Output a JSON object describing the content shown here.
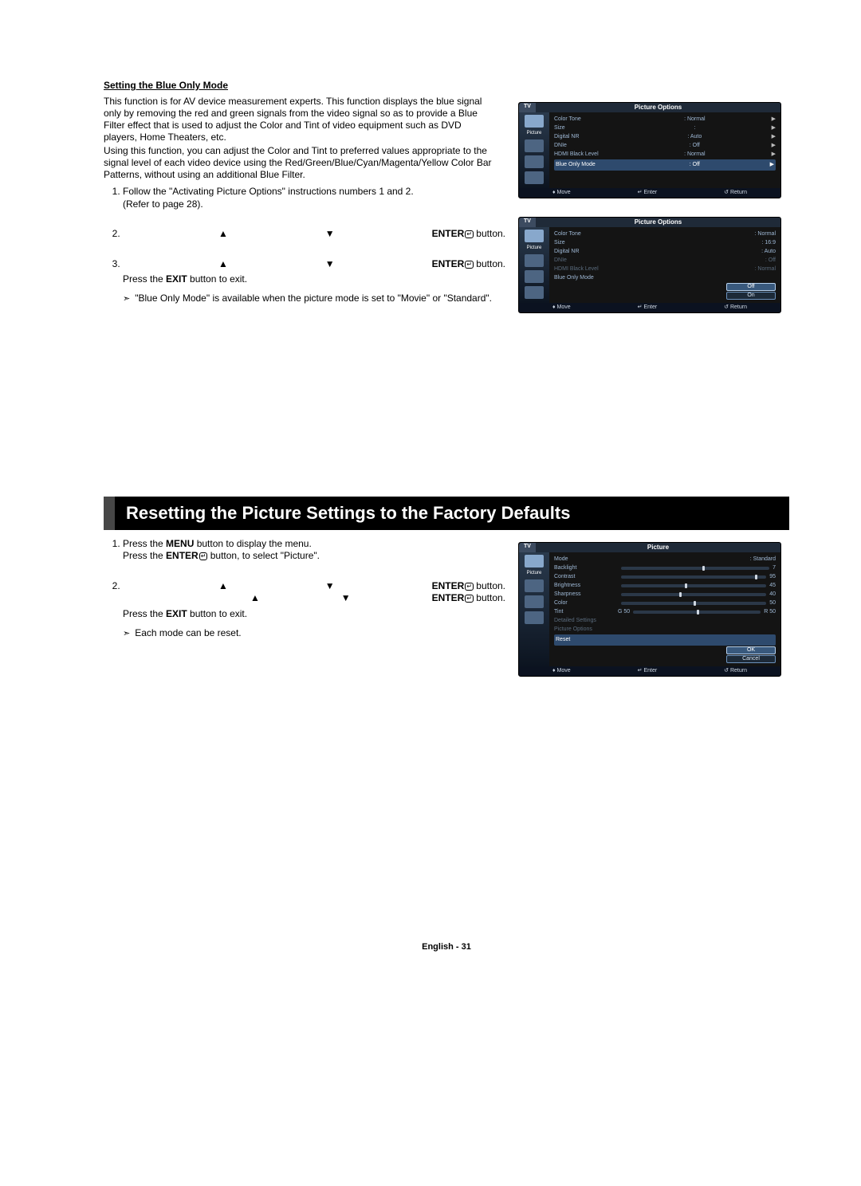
{
  "section1": {
    "heading": "Setting the Blue Only Mode",
    "intro1": "This function is for AV device measurement experts. This function displays the blue signal only by removing the red and green signals from the video signal so as to provide a Blue Filter effect that is used to adjust the Color and Tint of video equipment such as DVD players, Home Theaters, etc.",
    "intro2": "Using this function, you can adjust the Color and Tint to preferred values appropriate to the signal level of each video device using the Red/Green/Blue/Cyan/Magenta/Yellow Color Bar Patterns, without using an additional Blue Filter.",
    "step1a": "Follow the \"Activating Picture Options\" instructions numbers 1 and 2.",
    "step1b": "(Refer to page 28).",
    "step2_placeholder_a": "▲",
    "step2_placeholder_b": "▼",
    "enter_word": "ENTER",
    "button_word": " button.",
    "step3_placeholder_a": "▲",
    "step3_placeholder_b": "▼",
    "press_exit": "Press the ",
    "exit_bold": "EXIT",
    "press_exit_after": " button to exit.",
    "note": "\"Blue Only Mode\" is available when the picture mode is set to \"Movie\" or \"Standard\"."
  },
  "section2": {
    "title": "Resetting the Picture Settings to the Factory Defaults",
    "step1_a": "Press the ",
    "menu_bold": "MENU",
    "step1_b": " button to display the menu.",
    "step1_c": "Press the ",
    "step1_d": " button, to select \"Picture\".",
    "step2_placeholder_a": "▲",
    "step2_placeholder_b": "▼",
    "step2_placeholder_c": "▲",
    "step2_placeholder_d": "▼",
    "press_exit": "Press the ",
    "exit_bold": "EXIT",
    "press_exit_after": " button to exit.",
    "note": "Each mode can be reset."
  },
  "osd1": {
    "tab": "TV",
    "title": "Picture Options",
    "sidebar_label": "Picture",
    "rows": [
      {
        "lbl": "Color Tone",
        "val": "Normal",
        "arrow": "▶"
      },
      {
        "lbl": "Size",
        "val": "",
        "arrow": "▶"
      },
      {
        "lbl": "Digital NR",
        "val": "Auto",
        "arrow": "▶"
      },
      {
        "lbl": "DNIe",
        "val": "Off",
        "arrow": "▶"
      },
      {
        "lbl": "HDMI Black Level",
        "val": "Normal",
        "arrow": "▶"
      },
      {
        "lbl": "Blue Only Mode",
        "val": "Off",
        "arrow": "▶",
        "hl": true
      }
    ],
    "footer": {
      "move": "Move",
      "enter": "Enter",
      "return": "Return"
    }
  },
  "osd2": {
    "tab": "TV",
    "title": "Picture Options",
    "sidebar_label": "Picture",
    "rows": [
      {
        "lbl": "Color Tone",
        "val": "Normal"
      },
      {
        "lbl": "Size",
        "val": "16:9"
      },
      {
        "lbl": "Digital NR",
        "val": "Auto"
      },
      {
        "lbl": "DNIe",
        "val": "Off",
        "dim": true
      },
      {
        "lbl": "HDMI Black Level",
        "val": "Normal",
        "dim": true
      },
      {
        "lbl": "Blue Only Mode",
        "val": ""
      }
    ],
    "options": [
      "Off",
      "On"
    ],
    "selected_option": 0,
    "footer": {
      "move": "Move",
      "enter": "Enter",
      "return": "Return"
    }
  },
  "osd3": {
    "tab": "TV",
    "title": "Picture",
    "sidebar_label": "Picture",
    "mode_lbl": "Mode",
    "mode_val": "Standard",
    "sliders": [
      {
        "lbl": "Backlight",
        "val": "7",
        "pos": 55
      },
      {
        "lbl": "Contrast",
        "val": "95",
        "pos": 92
      },
      {
        "lbl": "Brightness",
        "val": "45",
        "pos": 44
      },
      {
        "lbl": "Sharpness",
        "val": "40",
        "pos": 40
      },
      {
        "lbl": "Color",
        "val": "50",
        "pos": 50
      }
    ],
    "tint_lbl": "Tint",
    "tint_g": "G 50",
    "tint_r": "R 50",
    "detailed": "Detailed Settings",
    "picopts": "Picture Options",
    "reset": "Reset",
    "ok": "OK",
    "cancel": "Cancel",
    "footer": {
      "move": "Move",
      "enter": "Enter",
      "return": "Return"
    }
  },
  "footer": "English - 31"
}
